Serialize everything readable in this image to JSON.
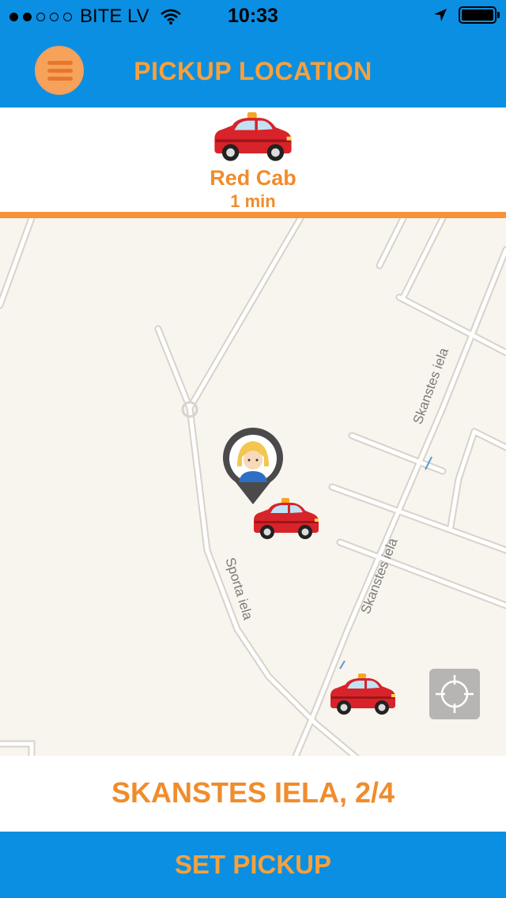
{
  "status_bar": {
    "carrier": "BITE LV",
    "time": "10:33",
    "signal_strength": 2,
    "battery_percent": 90
  },
  "header": {
    "title": "PICKUP LOCATION",
    "menu_icon": "hamburger-menu-icon"
  },
  "cab_selector": {
    "options": [
      {
        "name": "Red Cab",
        "eta": "1 min",
        "icon": "red-taxi-icon"
      }
    ]
  },
  "map": {
    "street_labels": [
      "Skanstes iela",
      "Skanstes iela",
      "Sporta iela"
    ],
    "user_pin_icon": "user-location-pin-icon",
    "cab_markers": 2,
    "locate_icon": "crosshair-locate-icon"
  },
  "address": {
    "text": "SKANSTES IELA, 2/4"
  },
  "actions": {
    "set_pickup_label": "SET PICKUP"
  },
  "colors": {
    "brand_blue": "#0b8fe3",
    "accent_orange": "#f7923a",
    "cab_red": "#d8232a"
  }
}
